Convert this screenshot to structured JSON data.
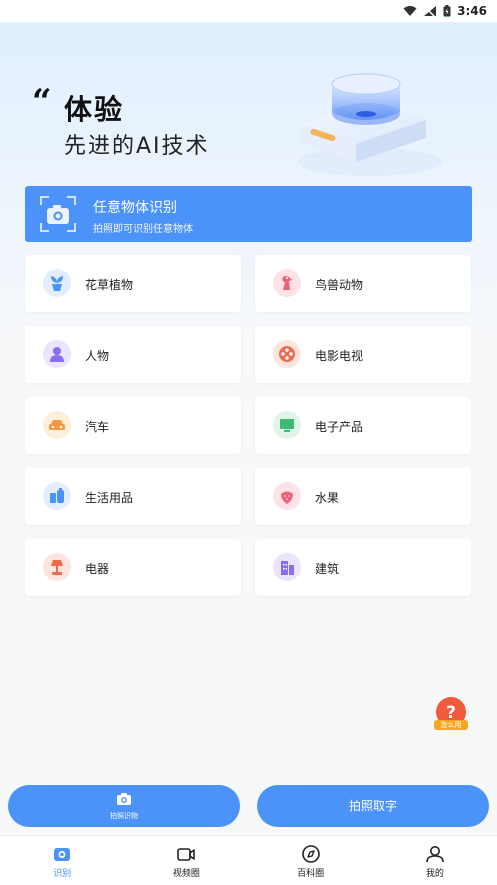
{
  "status_bar": {
    "time": "3:46"
  },
  "hero": {
    "quote_mark": "“",
    "title": "体验",
    "subtitle": "先进的AI技术"
  },
  "banner": {
    "title": "任意物体识别",
    "description": "拍照即可识别任意物体"
  },
  "categories": [
    {
      "label": "花草植物",
      "icon": "plant-icon",
      "color": "#4b93f8"
    },
    {
      "label": "鸟兽动物",
      "icon": "animal-icon",
      "color": "#f0607a"
    },
    {
      "label": "人物",
      "icon": "person-icon",
      "color": "#8a6df0"
    },
    {
      "label": "电影电视",
      "icon": "film-reel-icon",
      "color": "#f06a4e"
    },
    {
      "label": "汽车",
      "icon": "car-icon",
      "color": "#f59a3c"
    },
    {
      "label": "电子产品",
      "icon": "monitor-icon",
      "color": "#3dbb72"
    },
    {
      "label": "生活用品",
      "icon": "daily-goods-icon",
      "color": "#4b93f8"
    },
    {
      "label": "水果",
      "icon": "strawberry-icon",
      "color": "#f0607a"
    },
    {
      "label": "电器",
      "icon": "lamp-icon",
      "color": "#f06a4e"
    },
    {
      "label": "建筑",
      "icon": "building-icon",
      "color": "#8a6df0"
    }
  ],
  "help_badge": {
    "label": "怎么用"
  },
  "buttons": {
    "left_label": "拍照识物",
    "right_label": "拍照取字"
  },
  "tabs": [
    {
      "label": "识别",
      "icon": "camera-icon",
      "active": true
    },
    {
      "label": "视频圈",
      "icon": "video-icon",
      "active": false
    },
    {
      "label": "百科圈",
      "icon": "compass-icon",
      "active": false
    },
    {
      "label": "我的",
      "icon": "user-icon",
      "active": false
    }
  ],
  "colors": {
    "accent": "#4b93f8",
    "background": "#f7f8fa"
  }
}
